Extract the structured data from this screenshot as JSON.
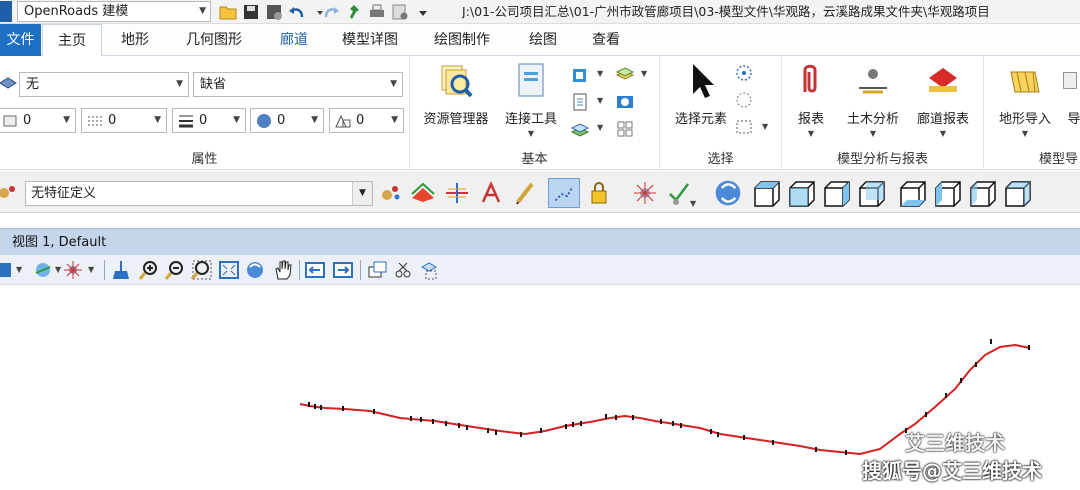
{
  "quick_access": {
    "workspace": "OpenRoads 建模",
    "path": "J:\\01-公司项目汇总\\01-广州市政管廊项目\\03-模型文件\\华观路，云溪路成果文件夹\\华观路项目"
  },
  "tabs": [
    {
      "label": "文件"
    },
    {
      "label": "主页"
    },
    {
      "label": "地形"
    },
    {
      "label": "几何图形"
    },
    {
      "label": "廊道"
    },
    {
      "label": "模型详图"
    },
    {
      "label": "绘图制作"
    },
    {
      "label": "绘图"
    },
    {
      "label": "查看"
    }
  ],
  "ribbon": {
    "attributes": {
      "level_value": "无",
      "color_value": "缺省",
      "weight_value": "0",
      "style_value": "0",
      "class_value": "0",
      "transparency_value": "0",
      "priority_value": "0",
      "label": "属性"
    },
    "basic": {
      "explorer": "资源管理器",
      "connect": "连接工具",
      "label": "基本"
    },
    "selection": {
      "select": "选择元素",
      "label": "选择"
    },
    "analysis": {
      "report": "报表",
      "civil": "土木分析",
      "corridor_report": "廊道报表",
      "label": "模型分析与报表"
    },
    "import": {
      "terrain_import": "地形导入",
      "more": "导",
      "label": "模型导"
    }
  },
  "feature_bar": {
    "feature_def": "无特征定义"
  },
  "view": {
    "title": "视图 1, Default"
  },
  "watermark": {
    "line1": "艾三维技术",
    "line2": "搜狐号@艾三维技术"
  },
  "colors": {
    "accent": "#1f6fc5",
    "alignment": "#d42020",
    "view_title_bg": "#c5d6ea"
  }
}
